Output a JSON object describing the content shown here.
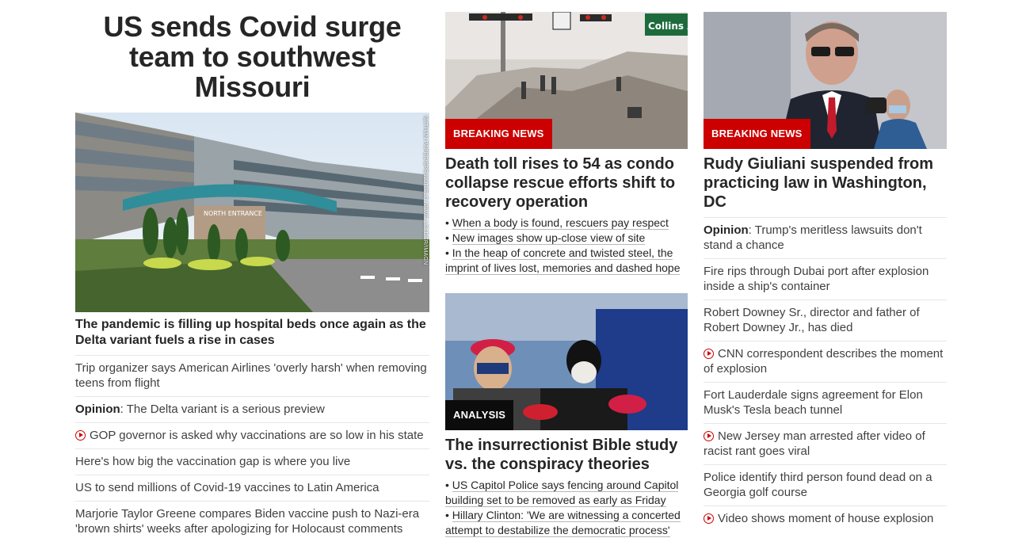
{
  "left": {
    "hero_title": "US sends Covid surge team to southwest Missouri",
    "image_credit": "NATHAN PAPES/SPRINGFIELD NEWS-LEADER/IMAGN",
    "image_sign": "NORTH ENTRANCE",
    "hero_headline": "The pandemic is filling up hospital beds once again as the Delta variant fuels a rise in cases",
    "stories": [
      {
        "prefix": "",
        "text": "Trip organizer says American Airlines 'overly harsh' when removing teens from flight",
        "video": false
      },
      {
        "prefix": "Opinion",
        "text": ": The Delta variant is a serious preview",
        "video": false
      },
      {
        "prefix": "",
        "text": "GOP governor is asked why vaccinations are so low in his state",
        "video": true
      },
      {
        "prefix": "",
        "text": "Here's how big the vaccination gap is where you live",
        "video": false
      },
      {
        "prefix": "",
        "text": "US to send millions of Covid-19 vaccines to Latin America",
        "video": false
      },
      {
        "prefix": "",
        "text": "Marjorie Taylor Greene compares Biden vaccine push to Nazi-era 'brown shirts' weeks after apologizing for Holocaust comments",
        "video": false
      }
    ]
  },
  "middle": {
    "card1": {
      "badge": "BREAKING NEWS",
      "street_sign": "Collins A",
      "title": "Death toll rises to 54 as condo collapse rescue efforts shift to recovery operation",
      "bullets": [
        "When a body is found, rescuers pay respect",
        "New images show up-close view of site",
        "In the heap of concrete and twisted steel, the imprint of lives lost, memories and dashed hope"
      ]
    },
    "card2": {
      "badge": "ANALYSIS",
      "title": "The insurrectionist Bible study vs. the conspiracy theories",
      "bullets": [
        "US Capitol Police says fencing around Capitol building set to be removed as early as Friday",
        "Hillary Clinton: 'We are witnessing a concerted attempt to destabilize the democratic process'"
      ]
    }
  },
  "right": {
    "badge": "BREAKING NEWS",
    "title": "Rudy Giuliani suspended from practicing law in Washington, DC",
    "stories": [
      {
        "prefix": "Opinion",
        "text": ": Trump's meritless lawsuits don't stand a chance",
        "video": false
      },
      {
        "prefix": "",
        "text": "Fire rips through Dubai port after explosion inside a ship's container",
        "video": false
      },
      {
        "prefix": "",
        "text": "Robert Downey Sr., director and father of Robert Downey Jr., has died",
        "video": false
      },
      {
        "prefix": "",
        "text": "CNN correspondent describes the moment of explosion",
        "video": true
      },
      {
        "prefix": "",
        "text": "Fort Lauderdale signs agreement for Elon Musk's Tesla beach tunnel",
        "video": false
      },
      {
        "prefix": "",
        "text": "New Jersey man arrested after video of racist rant goes viral",
        "video": true
      },
      {
        "prefix": "",
        "text": "Police identify third person found dead on a Georgia golf course",
        "video": false
      },
      {
        "prefix": "",
        "text": "Video shows moment of house explosion",
        "video": true
      }
    ]
  },
  "colors": {
    "badge_red": "#cc0000",
    "badge_dark": "#0c0c0c",
    "divider": "#e6e6e6",
    "text": "#262626"
  },
  "icons": {
    "video": "play-circle-icon"
  }
}
